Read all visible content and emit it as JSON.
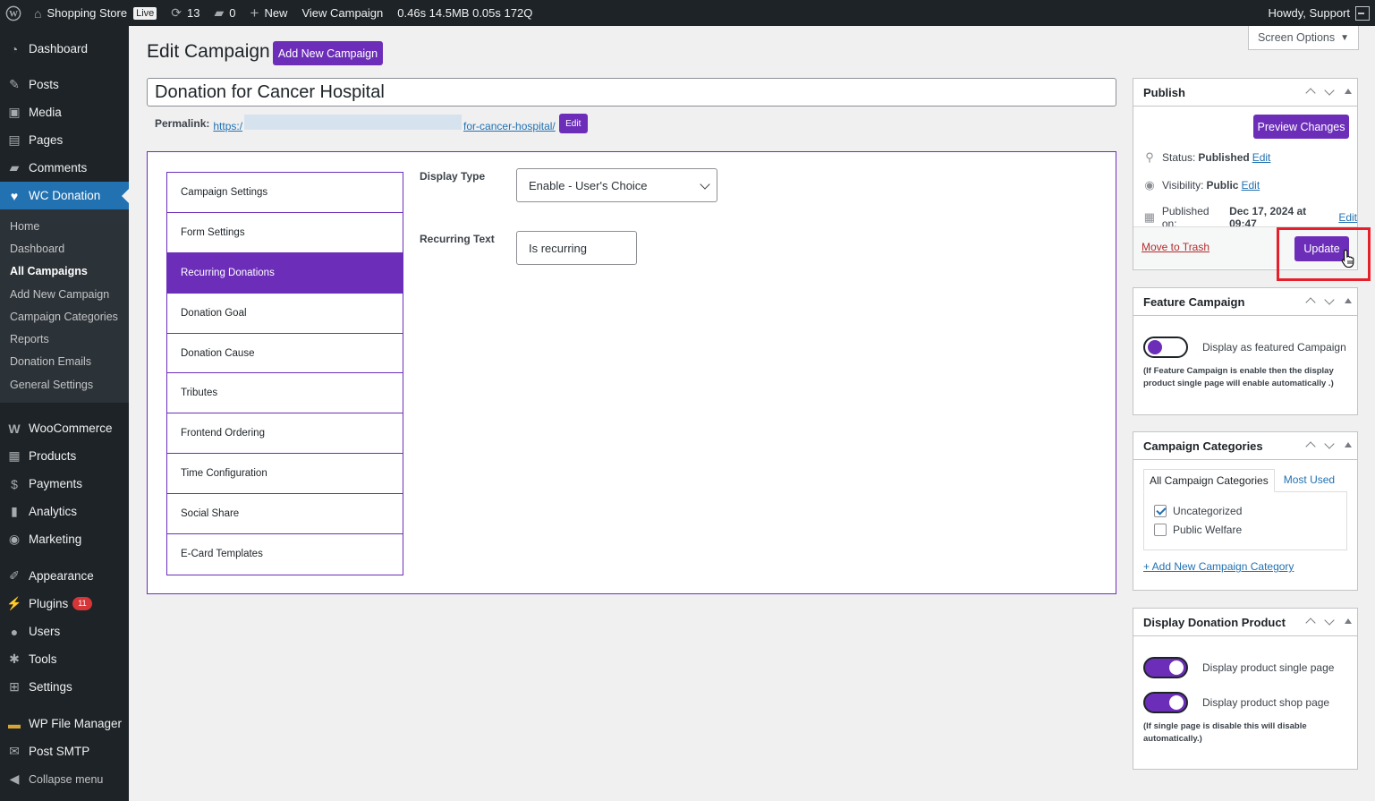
{
  "adminbar": {
    "site_name": "Shopping Store",
    "live_badge": "Live",
    "updates_count": "13",
    "comments_count": "0",
    "new_label": "New",
    "view_campaign": "View Campaign",
    "perf": "0.46s  14.5MB  0.05s  172Q",
    "howdy": "Howdy, Support"
  },
  "sidebar": {
    "top_items": [
      {
        "label": "Dashboard",
        "icon": "dashboard-icon"
      },
      {
        "label": "Posts",
        "icon": "pin-icon"
      },
      {
        "label": "Media",
        "icon": "media-icon"
      },
      {
        "label": "Pages",
        "icon": "pages-icon"
      },
      {
        "label": "Comments",
        "icon": "comments-icon"
      },
      {
        "label": "WC Donation",
        "icon": "heart-icon"
      }
    ],
    "submenu": [
      "Home",
      "Dashboard",
      "All Campaigns",
      "Add New Campaign",
      "Campaign Categories",
      "Reports",
      "Donation Emails",
      "General Settings"
    ],
    "bottom_items": [
      {
        "label": "WooCommerce",
        "icon": "woo-icon"
      },
      {
        "label": "Products",
        "icon": "products-icon"
      },
      {
        "label": "Payments",
        "icon": "payments-icon"
      },
      {
        "label": "Analytics",
        "icon": "analytics-icon"
      },
      {
        "label": "Marketing",
        "icon": "marketing-icon"
      },
      {
        "label": "Appearance",
        "icon": "appearance-icon"
      },
      {
        "label": "Plugins",
        "icon": "plugins-icon",
        "badge": "11"
      },
      {
        "label": "Users",
        "icon": "users-icon"
      },
      {
        "label": "Tools",
        "icon": "tools-icon"
      },
      {
        "label": "Settings",
        "icon": "settings-icon"
      },
      {
        "label": "WP File Manager",
        "icon": "file-manager-icon"
      },
      {
        "label": "Post SMTP",
        "icon": "email-icon"
      },
      {
        "label": "Collapse menu",
        "icon": "collapse-icon"
      }
    ]
  },
  "screen_options": "Screen Options",
  "page": {
    "title": "Edit Campaign",
    "add_new": "Add New Campaign",
    "campaign_title": "Donation for Cancer Hospital",
    "permalink_label": "Permalink:",
    "permalink_start": "https:/",
    "permalink_end": "for-cancer-hospital/",
    "permalink_edit": "Edit"
  },
  "campaign_tabs": [
    "Campaign Settings",
    "Form Settings",
    "Recurring Donations",
    "Donation Goal",
    "Donation Cause",
    "Tributes",
    "Frontend Ordering",
    "Time Configuration",
    "Social Share",
    "E-Card Templates"
  ],
  "recurring": {
    "display_type_label": "Display Type",
    "display_type_value": "Enable - User's Choice",
    "recurring_text_label": "Recurring Text",
    "recurring_text_value": "Is recurring"
  },
  "publish": {
    "title": "Publish",
    "preview": "Preview Changes",
    "status_label": "Status:",
    "status_value": "Published",
    "visibility_label": "Visibility:",
    "visibility_value": "Public",
    "published_label": "Published on:",
    "published_value": "Dec 17, 2024 at 09:47",
    "edit": "Edit",
    "trash": "Move to Trash",
    "update": "Update"
  },
  "feature": {
    "title": "Feature Campaign",
    "toggle_label": "Display as featured Campaign",
    "note": "(If Feature Campaign is enable then the display product single page will enable automatically .)"
  },
  "categories": {
    "title": "Campaign Categories",
    "tab_all": "All Campaign Categories",
    "tab_most": "Most Used",
    "items": [
      {
        "label": "Uncategorized",
        "checked": true
      },
      {
        "label": "Public Welfare",
        "checked": false
      }
    ],
    "add_new": "+ Add New Campaign Category"
  },
  "display_product": {
    "title": "Display Donation Product",
    "single_label": "Display product single page",
    "shop_label": "Display product shop page",
    "note": "(If single page is disable this will disable automatically.)"
  },
  "colors": {
    "accent": "#6c2eb9",
    "admin_blue": "#2271b1",
    "highlight": "#e5202a"
  }
}
